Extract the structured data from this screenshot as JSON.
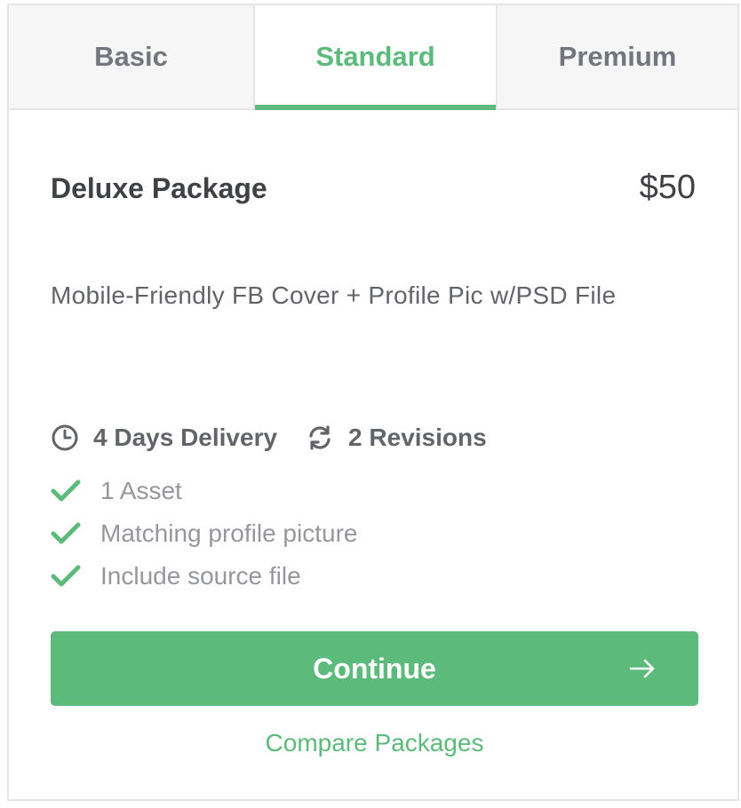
{
  "tabs": [
    {
      "label": "Basic"
    },
    {
      "label": "Standard"
    },
    {
      "label": "Premium"
    }
  ],
  "active_tab": "Standard",
  "package": {
    "title": "Deluxe Package",
    "price": "$50",
    "description": "Mobile-Friendly FB Cover + Profile Pic w/PSD File"
  },
  "meta": {
    "delivery": "4 Days Delivery",
    "revisions": "2 Revisions"
  },
  "features": [
    "1 Asset",
    "Matching profile picture",
    "Include source file"
  ],
  "continue_label": "Continue",
  "compare_label": "Compare Packages",
  "colors": {
    "accent": "#5cbb7b",
    "text_dark": "#404145",
    "text_muted": "#95979d",
    "border": "#e4e5e7"
  },
  "icons": {
    "delivery": "clock-icon",
    "revisions": "refresh-icon",
    "feature": "check-icon",
    "continue": "arrow-right-icon"
  }
}
